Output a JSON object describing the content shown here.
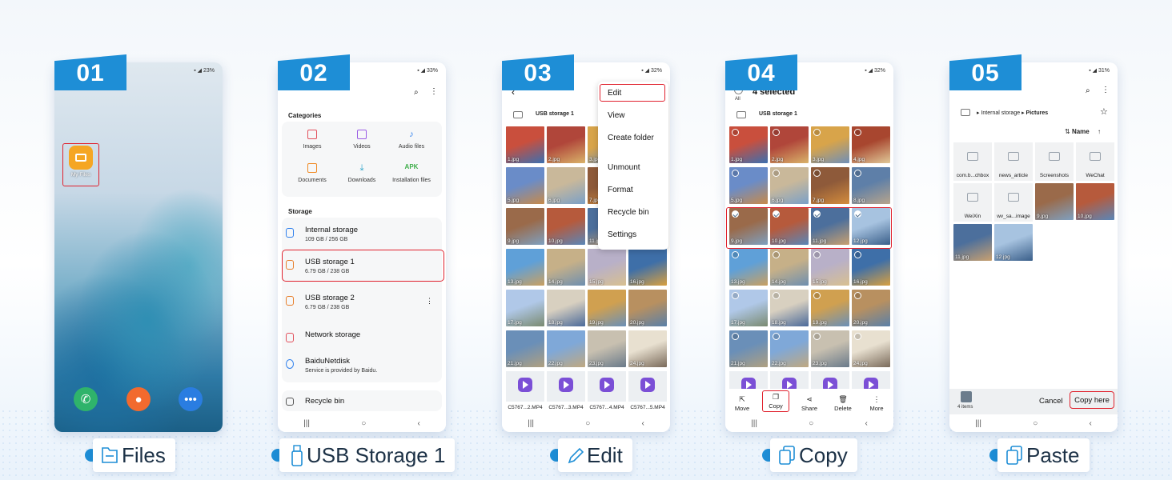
{
  "steps": [
    {
      "num": "01",
      "status": "23%",
      "label": "Files",
      "icon": "folder-icon"
    },
    {
      "num": "02",
      "status": "33%",
      "label": "USB Storage 1",
      "icon": "usb-icon"
    },
    {
      "num": "03",
      "status": "32%",
      "label": "Edit",
      "icon": "pencil-icon"
    },
    {
      "num": "04",
      "status": "32%",
      "label": "Copy",
      "icon": "copy-icon"
    },
    {
      "num": "05",
      "status": "31%",
      "label": "Paste",
      "icon": "paste-icon"
    }
  ],
  "home": {
    "app_label": "My Files"
  },
  "myfiles": {
    "categories_title": "Categories",
    "categories": [
      {
        "label": "Images",
        "color": "#e2505c"
      },
      {
        "label": "Videos",
        "color": "#9b5de5"
      },
      {
        "label": "Audio files",
        "color": "#2f80ed"
      },
      {
        "label": "Documents",
        "color": "#f08a24"
      },
      {
        "label": "Downloads",
        "color": "#2aa3c9"
      },
      {
        "label": "Installation files",
        "color": "#3fae4a"
      }
    ],
    "apk_text": "APK",
    "storage_title": "Storage",
    "storage": [
      {
        "name": "Internal storage",
        "sub": "109 GB / 256 GB"
      },
      {
        "name": "USB storage 1",
        "sub": "6.79 GB / 238 GB"
      },
      {
        "name": "USB storage 2",
        "sub": "6.79 GB / 238 GB"
      },
      {
        "name": "Network storage",
        "sub": ""
      },
      {
        "name": "BaiduNetdisk",
        "sub": "Service is provided by Baidu."
      }
    ],
    "recycle": "Recycle bin"
  },
  "usb": {
    "crumb": "USB storage 1",
    "menu": [
      "Edit",
      "View",
      "Create folder",
      "Unmount",
      "Format",
      "Recycle bin",
      "Settings"
    ],
    "photos": [
      "1.jpg",
      "2.jpg",
      "3.jpg",
      "4.jpg",
      "5.jpg",
      "6.jpg",
      "7.jpg",
      "8.jpg",
      "9.jpg",
      "10.jpg",
      "11.jpg",
      "12.jpg",
      "13.jpg",
      "14.jpg",
      "15.jpg",
      "16.jpg",
      "17.jpg",
      "18.jpg",
      "19.jpg",
      "20.jpg",
      "21.jpg",
      "22.jpg",
      "23.jpg",
      "24.jpg"
    ],
    "videos": [
      "C5767...2.MP4",
      "C5767...3.MP4",
      "C5767...4.MP4",
      "C5767...5.MP4"
    ]
  },
  "select": {
    "all": "All",
    "count": "4 selected",
    "actions": [
      "Move",
      "Copy",
      "Share",
      "Delete",
      "More"
    ]
  },
  "paste": {
    "crumb_root": "Internal storage",
    "crumb_leaf": "Pictures",
    "sort": "Name",
    "folders": [
      "com.b...chbox",
      "news_article",
      "Screenshots",
      "WeChat",
      "WeiXin",
      "wv_sa...image"
    ],
    "files": [
      "9.jpg",
      "10.jpg",
      "11.jpg",
      "12.jpg"
    ],
    "items": "4 items",
    "cancel": "Cancel",
    "copy_here": "Copy here"
  }
}
